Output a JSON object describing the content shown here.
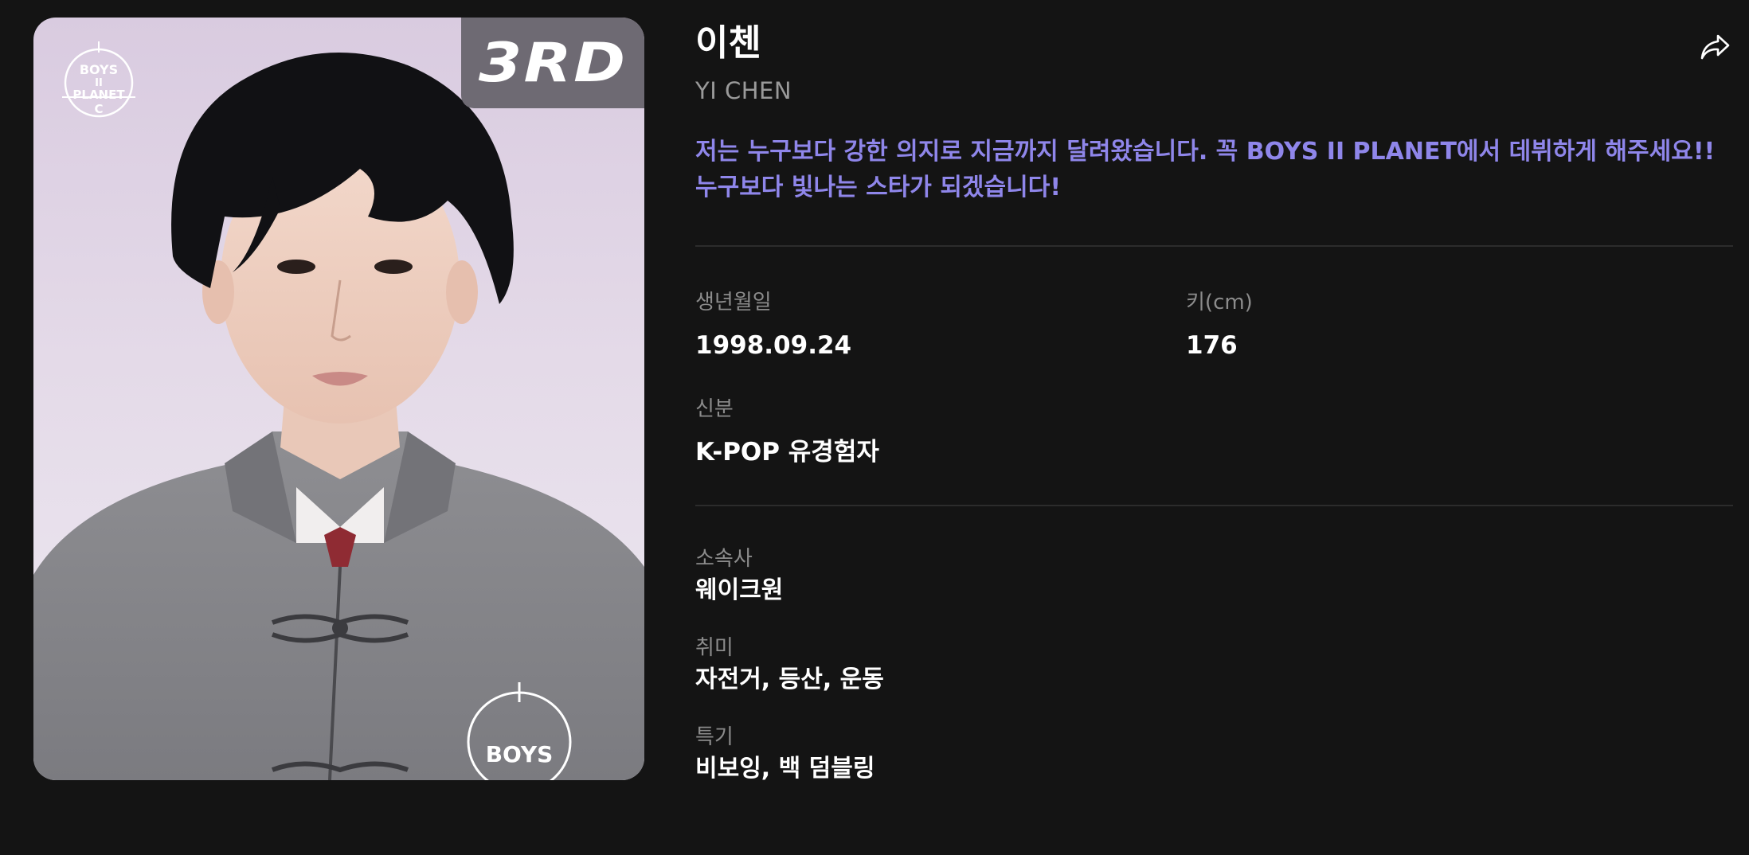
{
  "profile": {
    "name_kr": "이첸",
    "name_en": "YI CHEN",
    "rank_badge": "3RD",
    "logo_text": [
      "BOYS",
      "II",
      "PLANET",
      "C"
    ],
    "message": "저는 누구보다 강한 의지로 지금까지 달려왔습니다. 꼭 BOYS II PLANET에서 데뷔하게 해주세요!! 누구보다 빛나는 스타가 되겠습니다!",
    "message_color": "#8f86ea"
  },
  "stats": {
    "birth_label": "생년월일",
    "birth_value": "1998.09.24",
    "height_label": "키(cm)",
    "height_value": "176",
    "status_label": "신분",
    "status_value": "K-POP 유경험자"
  },
  "details": {
    "agency_label": "소속사",
    "agency_value": "웨이크원",
    "hobby_label": "취미",
    "hobby_value": "자전거, 등산, 운동",
    "skill_label": "특기",
    "skill_value": "비보잉, 백 덤블링"
  },
  "icons": {
    "share": "share-icon"
  },
  "colors": {
    "background": "#141414",
    "accent": "#8f86ea",
    "badge": "#6e6a73"
  }
}
